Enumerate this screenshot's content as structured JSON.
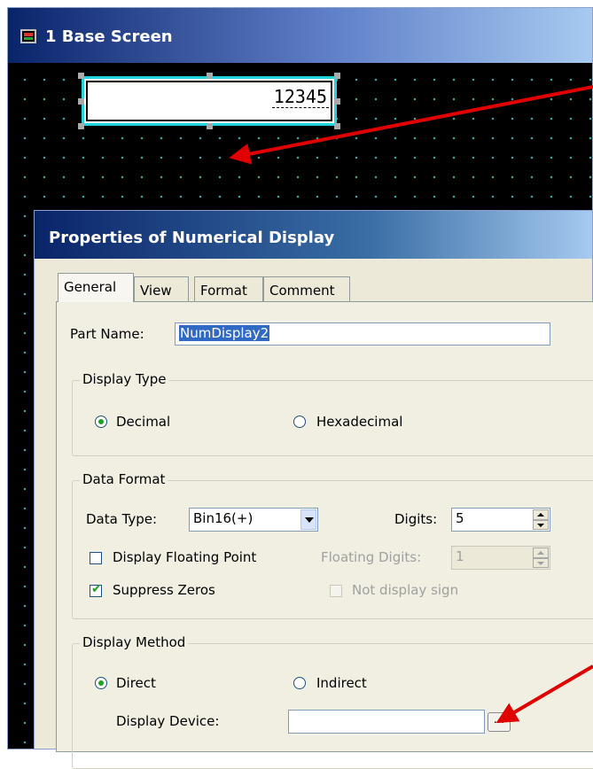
{
  "base_window": {
    "title": "1  Base Screen"
  },
  "canvas_part": {
    "value": "12345"
  },
  "dialog": {
    "title": "Properties of Numerical Display",
    "tabs": [
      {
        "label": "General",
        "active": true
      },
      {
        "label": "View",
        "active": false
      },
      {
        "label": "Format",
        "active": false
      },
      {
        "label": "Comment",
        "active": false
      }
    ],
    "part_name": {
      "label": "Part Name:",
      "value": "NumDisplay2"
    },
    "display_type": {
      "title": "Display Type",
      "options": [
        {
          "label": "Decimal",
          "checked": true
        },
        {
          "label": "Hexadecimal",
          "checked": false
        }
      ]
    },
    "data_format": {
      "title": "Data Format",
      "data_type_label": "Data Type:",
      "data_type_value": "Bin16(+)",
      "digits_label": "Digits:",
      "digits_value": "5",
      "display_floating_point": {
        "label": "Display Floating Point",
        "checked": false
      },
      "floating_digits_label": "Floating Digits:",
      "floating_digits_value": "1",
      "suppress_zeros": {
        "label": "Suppress Zeros",
        "checked": true
      },
      "not_display_sign": {
        "label": "Not display sign",
        "checked": false
      }
    },
    "display_method": {
      "title": "Display Method",
      "options": [
        {
          "label": "Direct",
          "checked": true
        },
        {
          "label": "Indirect",
          "checked": false
        }
      ],
      "display_device_label": "Display Device:",
      "display_device_value": "",
      "browse_label": "..."
    }
  },
  "colors": {
    "annotation_arrow": "#e00000",
    "selection_border": "#22d3e0",
    "title_bar": "#0a246a"
  }
}
